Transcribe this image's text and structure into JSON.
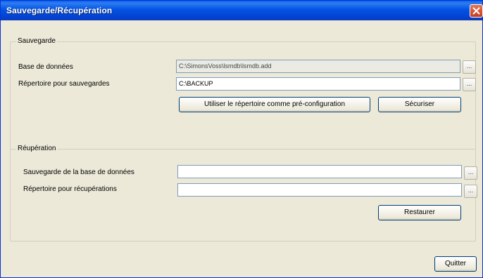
{
  "window": {
    "title": "Sauvegarde/Récupération",
    "close_icon": "close-icon"
  },
  "backup": {
    "legend": "Sauvegarde",
    "database_label": "Base de données",
    "database_value": "C:\\SimonsVoss\\lsmdb\\lsmdb.add",
    "directory_label": "Répertoire pour sauvegardes",
    "directory_value": "C:\\BACKUP",
    "browse_label": "...",
    "use_directory_button": "Utiliser le répertoire comme pré-configuration",
    "secure_button": "Sécuriser"
  },
  "restore": {
    "legend": "Réupération",
    "database_backup_label": "Sauvegarde de la base de données",
    "database_backup_value": "",
    "directory_label": "Répertoire pour récupérations",
    "directory_value": "",
    "browse_label": "...",
    "restore_button": "Restaurer"
  },
  "footer": {
    "quit_button": "Quitter"
  }
}
